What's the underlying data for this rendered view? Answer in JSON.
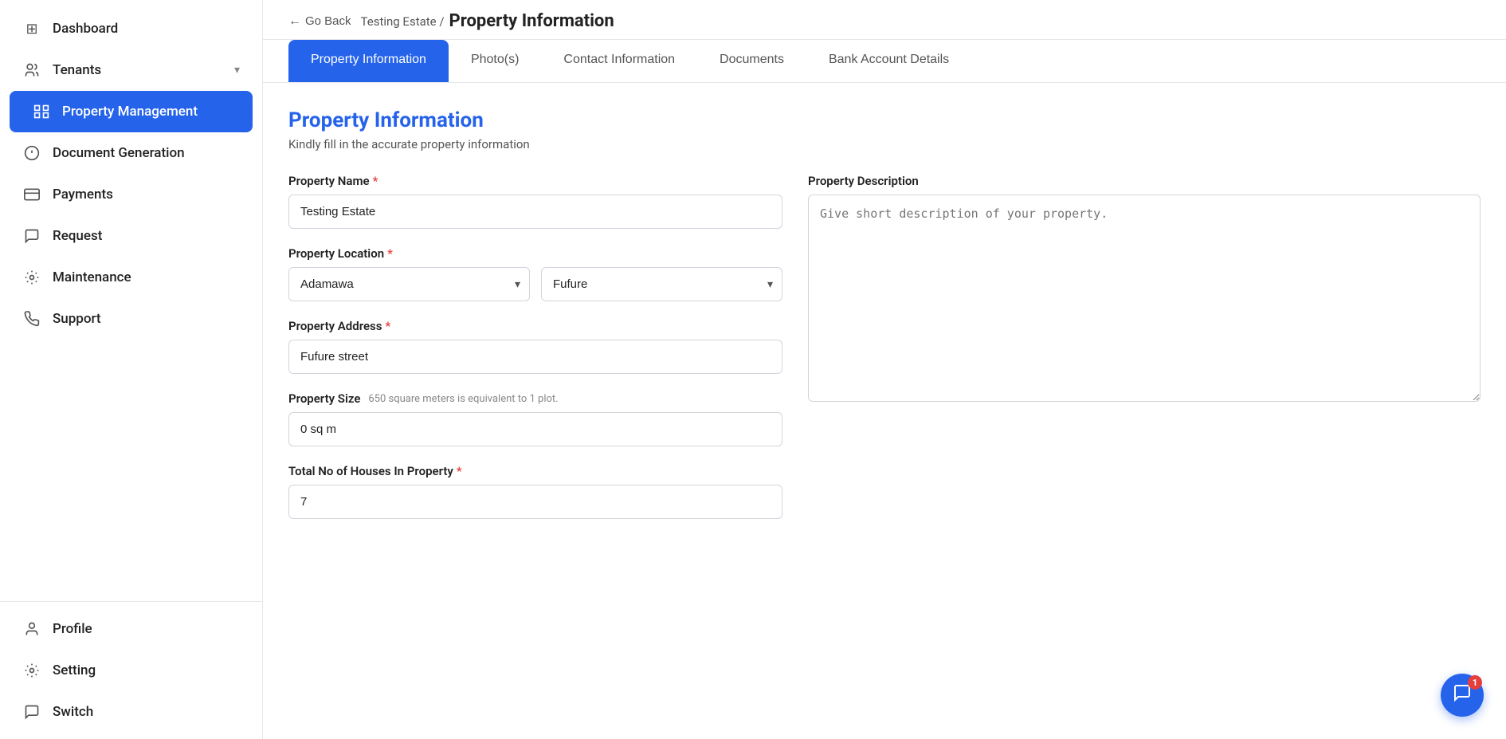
{
  "sidebar": {
    "items": [
      {
        "id": "dashboard",
        "label": "Dashboard",
        "icon": "⊞",
        "active": false
      },
      {
        "id": "tenants",
        "label": "Tenants",
        "icon": "👤",
        "active": false,
        "hasChevron": true
      },
      {
        "id": "property-management",
        "label": "Property Management",
        "icon": "🏠",
        "active": true
      },
      {
        "id": "document-generation",
        "label": "Document Generation",
        "icon": "📋",
        "active": false
      },
      {
        "id": "payments",
        "label": "Payments",
        "icon": "💳",
        "active": false
      },
      {
        "id": "request",
        "label": "Request",
        "icon": "📥",
        "active": false
      },
      {
        "id": "maintenance",
        "label": "Maintenance",
        "icon": "⚙",
        "active": false
      },
      {
        "id": "support",
        "label": "Support",
        "icon": "📞",
        "active": false
      }
    ],
    "bottom_items": [
      {
        "id": "profile",
        "label": "Profile",
        "icon": "👤",
        "active": false
      },
      {
        "id": "setting",
        "label": "Setting",
        "icon": "⚙",
        "active": false
      },
      {
        "id": "switch",
        "label": "Switch",
        "icon": "💬",
        "active": false
      }
    ]
  },
  "breadcrumb": {
    "back_label": "Go Back",
    "estate_name": "Testing Estate /",
    "current_page": "Property Information"
  },
  "tabs": [
    {
      "id": "property-info",
      "label": "Property Information",
      "active": true
    },
    {
      "id": "photos",
      "label": "Photo(s)",
      "active": false
    },
    {
      "id": "contact-info",
      "label": "Contact Information",
      "active": false
    },
    {
      "id": "documents",
      "label": "Documents",
      "active": false
    },
    {
      "id": "bank-account",
      "label": "Bank Account Details",
      "active": false
    }
  ],
  "form": {
    "title": "Property Information",
    "subtitle": "Kindly fill in the accurate property information",
    "fields": {
      "property_name": {
        "label": "Property Name",
        "required": true,
        "value": "Testing Estate",
        "placeholder": ""
      },
      "property_location": {
        "label": "Property Location",
        "required": true,
        "state_value": "Adamawa",
        "city_value": "Fufure",
        "state_placeholder": "Adamawa",
        "city_placeholder": "Fufure"
      },
      "property_address": {
        "label": "Property Address",
        "required": true,
        "value": "Fufure street",
        "placeholder": ""
      },
      "property_size": {
        "label": "Property Size",
        "hint": "650 square meters is equivalent to 1 plot.",
        "required": false,
        "value": "0 sq m",
        "placeholder": ""
      },
      "total_houses": {
        "label": "Total No of Houses In Property",
        "required": true,
        "value": "7",
        "placeholder": ""
      }
    },
    "description": {
      "label": "Property Description",
      "placeholder": "Give short description of your property.",
      "value": ""
    }
  },
  "chat": {
    "badge": "1"
  }
}
